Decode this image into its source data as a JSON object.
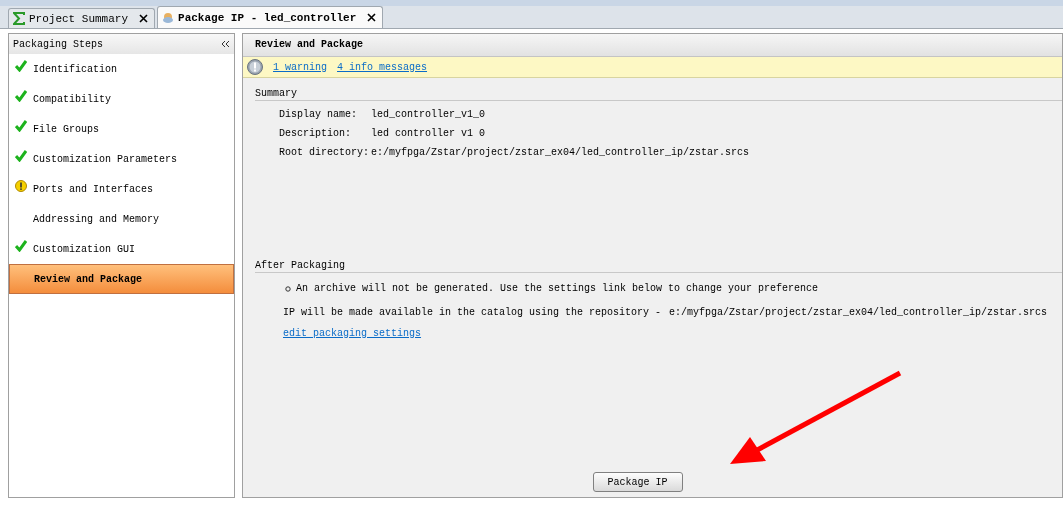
{
  "tabs": [
    {
      "label": "Project Summary",
      "kind": "summary",
      "selected": false
    },
    {
      "label": "Package IP - led_controller",
      "kind": "package",
      "selected": true
    }
  ],
  "sidebar": {
    "title": "Packaging Steps",
    "items": [
      {
        "label": "Identification",
        "kind": "done",
        "selected": false
      },
      {
        "label": "Compatibility",
        "kind": "done",
        "selected": false
      },
      {
        "label": "File Groups",
        "kind": "done",
        "selected": false
      },
      {
        "label": "Customization Parameters",
        "kind": "done",
        "selected": false
      },
      {
        "label": "Ports and Interfaces",
        "kind": "warning",
        "selected": false
      },
      {
        "label": "Addressing and Memory",
        "kind": "pending",
        "selected": false
      },
      {
        "label": "Customization GUI",
        "kind": "done",
        "selected": false
      },
      {
        "label": "Review and Package",
        "kind": "pending",
        "selected": true
      }
    ]
  },
  "main": {
    "title": "Review and Package",
    "messages": [
      "1 warning",
      "4 info messages"
    ],
    "summary": {
      "heading": "Summary",
      "fields": [
        {
          "label": "Display name:",
          "value": "led_controller_v1_0"
        },
        {
          "label": "Description:",
          "value": "led controller v1 0"
        },
        {
          "label": "Root directory:",
          "value": "e:/myfpga/Zstar/project/zstar_ex04/led_controller_ip/zstar.srcs"
        }
      ]
    },
    "after": {
      "heading": "After Packaging",
      "bullet": "An archive will not be generated. Use the settings link below to change your preference",
      "repository_text": "IP will be made available in the catalog using the repository -",
      "repository_path": "e:/myfpga/Zstar/project/zstar_ex04/led_controller_ip/zstar.srcs",
      "link": "edit packaging settings"
    },
    "button": "Package IP"
  }
}
